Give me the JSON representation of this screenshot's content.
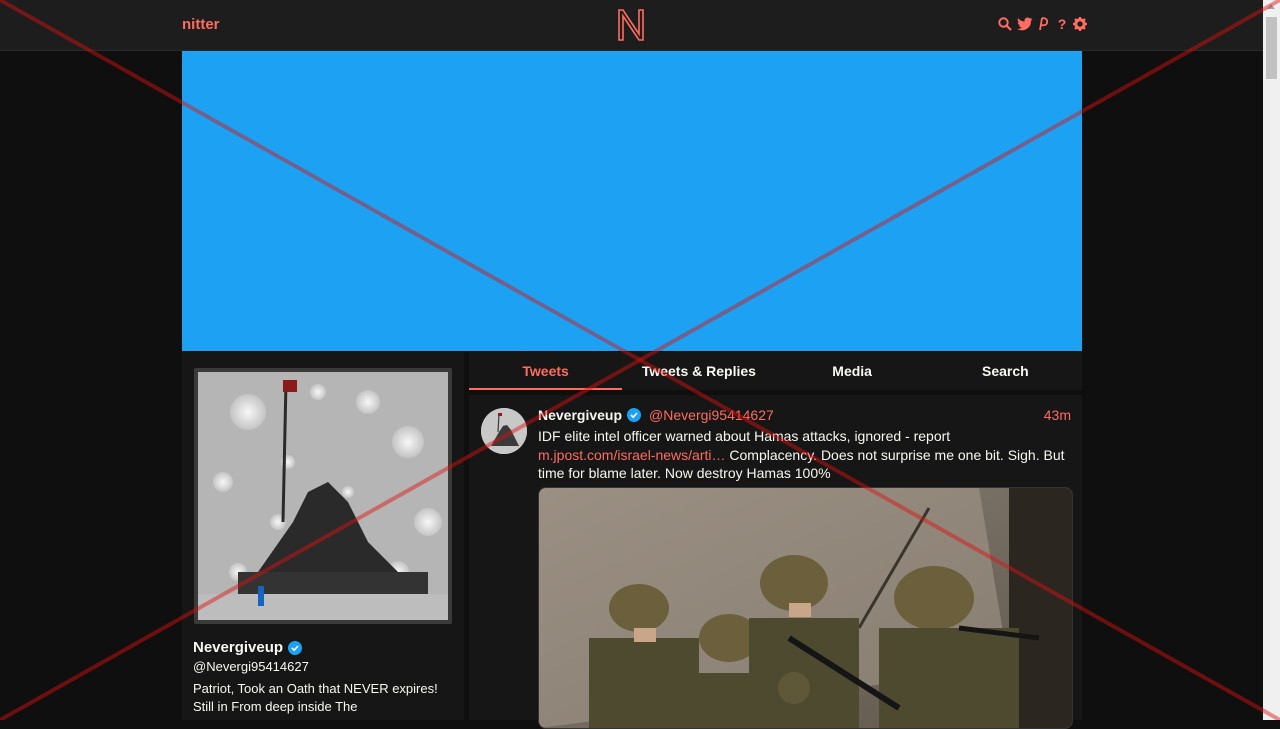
{
  "app": {
    "name": "nitter",
    "logo_letter": "N"
  },
  "nav_icons": [
    "search-icon",
    "twitter-bird-icon",
    "rss-icon",
    "help-icon",
    "gear-icon"
  ],
  "colors": {
    "accent": "#ff6c60",
    "banner": "#1da1f2",
    "background": "#0f0f0f",
    "panel": "#161616",
    "verified": "#1da1f2"
  },
  "profile": {
    "name": "Nevergiveup",
    "handle": "@Nevergi95414627",
    "bio": "Patriot, Took an Oath that NEVER expires! Still in From deep inside The"
  },
  "tabs": [
    {
      "label": "Tweets",
      "active": true
    },
    {
      "label": "Tweets & Replies",
      "active": false
    },
    {
      "label": "Media",
      "active": false
    },
    {
      "label": "Search",
      "active": false
    }
  ],
  "tweet": {
    "name": "Nevergiveup",
    "handle": "@Nevergi95414627",
    "time": "43m",
    "text_line1": "IDF elite intel officer warned about Hamas attacks, ignored - report",
    "link": "m.jpost.com/israel-news/arti…",
    "text_after_link": " Complacency. Does not surprise me one bit. Sigh. But time for blame later. Now destroy Hamas 100%"
  }
}
